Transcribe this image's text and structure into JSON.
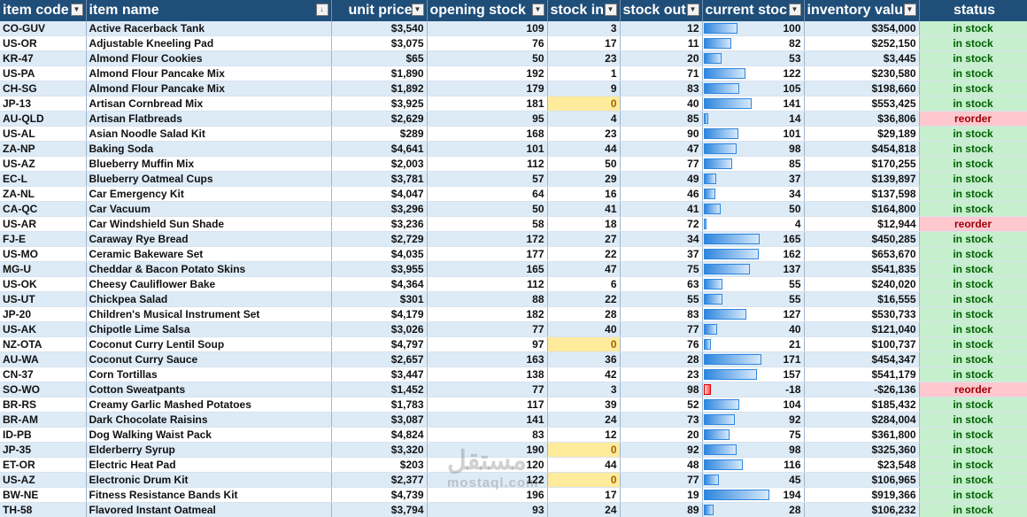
{
  "columns": [
    {
      "key": "code",
      "label": "item code",
      "icon": "filter-icon"
    },
    {
      "key": "name",
      "label": "item name",
      "icon": "sort-filter-icon"
    },
    {
      "key": "price",
      "label": "unit price",
      "icon": "filter-icon"
    },
    {
      "key": "open",
      "label": "opening stock",
      "icon": "filter-icon"
    },
    {
      "key": "in",
      "label": "stock in",
      "icon": "filter-icon"
    },
    {
      "key": "out",
      "label": "stock out",
      "icon": "filter-icon"
    },
    {
      "key": "current",
      "label": "current stoc",
      "icon": "filter-icon"
    },
    {
      "key": "value",
      "label": "inventory valu",
      "icon": "filter-icon"
    },
    {
      "key": "status",
      "label": "status"
    }
  ],
  "rows": [
    {
      "code": "CO-GUV",
      "name": "Active Racerback Tank",
      "price": "$3,540",
      "open": 109,
      "in": 3,
      "out": 12,
      "current": 100,
      "value": "$354,000",
      "status": "in stock"
    },
    {
      "code": "US-OR",
      "name": "Adjustable Kneeling Pad",
      "price": "$3,075",
      "open": 76,
      "in": 17,
      "out": 11,
      "current": 82,
      "value": "$252,150",
      "status": "in stock"
    },
    {
      "code": "KR-47",
      "name": "Almond Flour Cookies",
      "price": "$65",
      "open": 50,
      "in": 23,
      "out": 20,
      "current": 53,
      "value": "$3,445",
      "status": "in stock"
    },
    {
      "code": "US-PA",
      "name": "Almond Flour Pancake Mix",
      "price": "$1,890",
      "open": 192,
      "in": 1,
      "out": 71,
      "current": 122,
      "value": "$230,580",
      "status": "in stock"
    },
    {
      "code": "CH-SG",
      "name": "Almond Flour Pancake Mix",
      "price": "$1,892",
      "open": 179,
      "in": 9,
      "out": 83,
      "current": 105,
      "value": "$198,660",
      "status": "in stock"
    },
    {
      "code": "JP-13",
      "name": "Artisan Cornbread Mix",
      "price": "$3,925",
      "open": 181,
      "in": 0,
      "out": 40,
      "current": 141,
      "value": "$553,425",
      "status": "in stock"
    },
    {
      "code": "AU-QLD",
      "name": "Artisan Flatbreads",
      "price": "$2,629",
      "open": 95,
      "in": 4,
      "out": 85,
      "current": 14,
      "value": "$36,806",
      "status": "reorder"
    },
    {
      "code": "US-AL",
      "name": "Asian Noodle Salad Kit",
      "price": "$289",
      "open": 168,
      "in": 23,
      "out": 90,
      "current": 101,
      "value": "$29,189",
      "status": "in stock"
    },
    {
      "code": "ZA-NP",
      "name": "Baking Soda",
      "price": "$4,641",
      "open": 101,
      "in": 44,
      "out": 47,
      "current": 98,
      "value": "$454,818",
      "status": "in stock"
    },
    {
      "code": "US-AZ",
      "name": "Blueberry Muffin Mix",
      "price": "$2,003",
      "open": 112,
      "in": 50,
      "out": 77,
      "current": 85,
      "value": "$170,255",
      "status": "in stock"
    },
    {
      "code": "EC-L",
      "name": "Blueberry Oatmeal Cups",
      "price": "$3,781",
      "open": 57,
      "in": 29,
      "out": 49,
      "current": 37,
      "value": "$139,897",
      "status": "in stock"
    },
    {
      "code": "ZA-NL",
      "name": "Car Emergency Kit",
      "price": "$4,047",
      "open": 64,
      "in": 16,
      "out": 46,
      "current": 34,
      "value": "$137,598",
      "status": "in stock"
    },
    {
      "code": "CA-QC",
      "name": "Car Vacuum",
      "price": "$3,296",
      "open": 50,
      "in": 41,
      "out": 41,
      "current": 50,
      "value": "$164,800",
      "status": "in stock"
    },
    {
      "code": "US-AR",
      "name": "Car Windshield Sun Shade",
      "price": "$3,236",
      "open": 58,
      "in": 18,
      "out": 72,
      "current": 4,
      "value": "$12,944",
      "status": "reorder"
    },
    {
      "code": "FJ-E",
      "name": "Caraway Rye Bread",
      "price": "$2,729",
      "open": 172,
      "in": 27,
      "out": 34,
      "current": 165,
      "value": "$450,285",
      "status": "in stock"
    },
    {
      "code": "US-MO",
      "name": "Ceramic Bakeware Set",
      "price": "$4,035",
      "open": 177,
      "in": 22,
      "out": 37,
      "current": 162,
      "value": "$653,670",
      "status": "in stock"
    },
    {
      "code": "MG-U",
      "name": "Cheddar & Bacon Potato Skins",
      "price": "$3,955",
      "open": 165,
      "in": 47,
      "out": 75,
      "current": 137,
      "value": "$541,835",
      "status": "in stock"
    },
    {
      "code": "US-OK",
      "name": "Cheesy Cauliflower Bake",
      "price": "$4,364",
      "open": 112,
      "in": 6,
      "out": 63,
      "current": 55,
      "value": "$240,020",
      "status": "in stock"
    },
    {
      "code": "US-UT",
      "name": "Chickpea Salad",
      "price": "$301",
      "open": 88,
      "in": 22,
      "out": 55,
      "current": 55,
      "value": "$16,555",
      "status": "in stock"
    },
    {
      "code": "JP-20",
      "name": "Children's Musical Instrument Set",
      "price": "$4,179",
      "open": 182,
      "in": 28,
      "out": 83,
      "current": 127,
      "value": "$530,733",
      "status": "in stock"
    },
    {
      "code": "US-AK",
      "name": "Chipotle Lime Salsa",
      "price": "$3,026",
      "open": 77,
      "in": 40,
      "out": 77,
      "current": 40,
      "value": "$121,040",
      "status": "in stock"
    },
    {
      "code": "NZ-OTA",
      "name": "Coconut Curry Lentil Soup",
      "price": "$4,797",
      "open": 97,
      "in": 0,
      "out": 76,
      "current": 21,
      "value": "$100,737",
      "status": "in stock"
    },
    {
      "code": "AU-WA",
      "name": "Coconut Curry Sauce",
      "price": "$2,657",
      "open": 163,
      "in": 36,
      "out": 28,
      "current": 171,
      "value": "$454,347",
      "status": "in stock"
    },
    {
      "code": "CN-37",
      "name": "Corn Tortillas",
      "price": "$3,447",
      "open": 138,
      "in": 42,
      "out": 23,
      "current": 157,
      "value": "$541,179",
      "status": "in stock"
    },
    {
      "code": "SO-WO",
      "name": "Cotton Sweatpants",
      "price": "$1,452",
      "open": 77,
      "in": 3,
      "out": 98,
      "current": -18,
      "value": "-$26,136",
      "status": "reorder"
    },
    {
      "code": "BR-RS",
      "name": "Creamy Garlic Mashed Potatoes",
      "price": "$1,783",
      "open": 117,
      "in": 39,
      "out": 52,
      "current": 104,
      "value": "$185,432",
      "status": "in stock"
    },
    {
      "code": "BR-AM",
      "name": "Dark Chocolate Raisins",
      "price": "$3,087",
      "open": 141,
      "in": 24,
      "out": 73,
      "current": 92,
      "value": "$284,004",
      "status": "in stock"
    },
    {
      "code": "ID-PB",
      "name": "Dog Walking Waist Pack",
      "price": "$4,824",
      "open": 83,
      "in": 12,
      "out": 20,
      "current": 75,
      "value": "$361,800",
      "status": "in stock"
    },
    {
      "code": "JP-35",
      "name": "Elderberry Syrup",
      "price": "$3,320",
      "open": 190,
      "in": 0,
      "out": 92,
      "current": 98,
      "value": "$325,360",
      "status": "in stock"
    },
    {
      "code": "ET-OR",
      "name": "Electric Heat Pad",
      "price": "$203",
      "open": 120,
      "in": 44,
      "out": 48,
      "current": 116,
      "value": "$23,548",
      "status": "in stock"
    },
    {
      "code": "US-AZ",
      "name": "Electronic Drum Kit",
      "price": "$2,377",
      "open": 122,
      "in": 0,
      "out": 77,
      "current": 45,
      "value": "$106,965",
      "status": "in stock"
    },
    {
      "code": "BW-NE",
      "name": "Fitness Resistance Bands Kit",
      "price": "$4,739",
      "open": 196,
      "in": 17,
      "out": 19,
      "current": 194,
      "value": "$919,366",
      "status": "in stock"
    },
    {
      "code": "TH-58",
      "name": "Flavored Instant Oatmeal",
      "price": "$3,794",
      "open": 93,
      "in": 24,
      "out": 89,
      "current": 28,
      "value": "$106,232",
      "status": "in stock"
    }
  ],
  "bar_max": 194,
  "colors": {
    "header": "#1f4e79",
    "band": "#ddebf7",
    "ok": "#c6efce",
    "reorder": "#ffc7ce",
    "zero": "#ffeb9c",
    "bar": "#2e86de",
    "neg_bar": "#ff4a4a"
  },
  "watermark": {
    "arabic": "مستقل",
    "latin": "mostaql.com"
  }
}
